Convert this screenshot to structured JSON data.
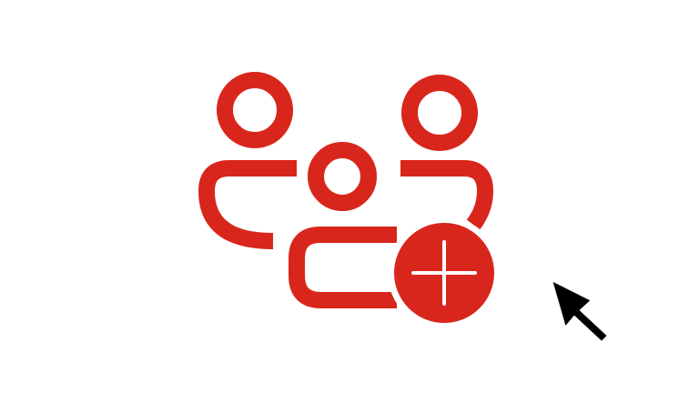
{
  "icons": {
    "main": "add-group-icon",
    "badge": "plus-icon",
    "pointer": "mouse-cursor-icon"
  },
  "colors": {
    "background": "#ffffff",
    "accent": "#d9261c",
    "badge_symbol": "#ffffff",
    "cursor": "#000000"
  }
}
